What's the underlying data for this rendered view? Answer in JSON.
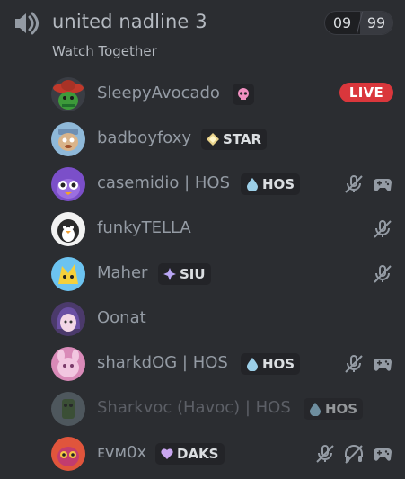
{
  "channel": {
    "name": "united nadline 3",
    "activity": "Watch Together",
    "counter_current": "09",
    "counter_max": "99",
    "icon": "speaker-icon"
  },
  "colors": {
    "background": "#2b2d31",
    "live": "#da373c",
    "text": "#949ba4"
  },
  "members": [
    {
      "name": "SleepyAvocado",
      "tag": "",
      "tag_icon": "skull-icon",
      "live": "LIVE"
    },
    {
      "name": "badboyfoxy",
      "tag": "STAR",
      "tag_icon": "diamond-sparkle-icon"
    },
    {
      "name": "casemidio | HOS",
      "tag": "HOS",
      "tag_icon": "water-drop-icon",
      "muted": true,
      "game": true
    },
    {
      "name": "funkyTELLA",
      "muted": true
    },
    {
      "name": "Maher",
      "tag": "SIU",
      "tag_icon": "purple-sparkle-icon",
      "muted": true
    },
    {
      "name": "Oonat"
    },
    {
      "name": "sharkdOG | HOS",
      "tag": "HOS",
      "tag_icon": "water-drop-icon",
      "muted": true,
      "game": true
    },
    {
      "name": "Sharkvoc (Havoc) | HOS",
      "tag": "HOS",
      "tag_icon": "water-drop-icon",
      "dim": true
    },
    {
      "name": "ᴇᴠᴍ0x",
      "tag": "DAKS",
      "tag_icon": "purple-heart-icon",
      "muted": true,
      "deafened": true,
      "game": true
    }
  ]
}
